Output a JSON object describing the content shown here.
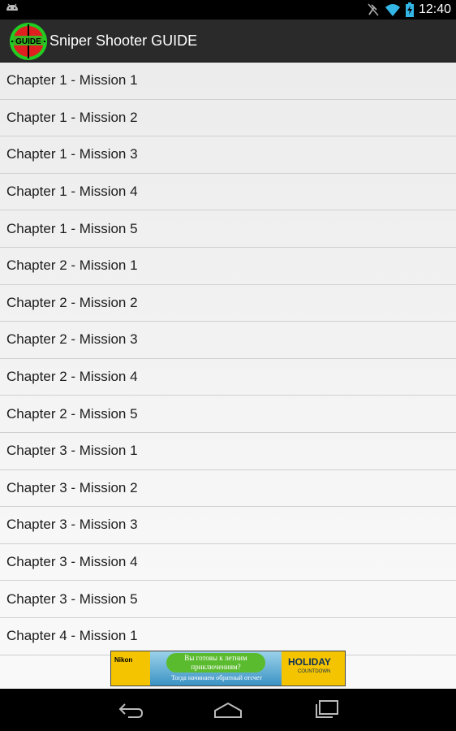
{
  "status_bar": {
    "time": "12:40",
    "icons": [
      "android-debug-icon",
      "no-sync-icon",
      "wifi-icon",
      "battery-charging-icon"
    ]
  },
  "action_bar": {
    "title": "Sniper Shooter GUIDE",
    "icon_label": "GUIDE"
  },
  "missions": [
    "Chapter 1 - Mission 1",
    "Chapter 1 - Mission 2",
    "Chapter 1 - Mission 3",
    "Chapter 1 - Mission 4",
    "Chapter 1 - Mission 5",
    "Chapter 2 - Mission 1",
    "Chapter 2 - Mission 2",
    "Chapter 2 - Mission 3",
    "Chapter 2 - Mission 4",
    "Chapter 2 - Mission 5",
    "Chapter 3 - Mission 1",
    "Chapter 3 - Mission 2",
    "Chapter 3 - Mission 3",
    "Chapter 3 - Mission 4",
    "Chapter 3 - Mission 5",
    "Chapter 4 - Mission 1"
  ],
  "ad": {
    "brand": "Nikon",
    "headline": "Вы готовы к летним приключениям?",
    "subline": "Тогда начинаем обратный отсчет",
    "holiday": "HOLIDAY",
    "countdown": "COUNTDOWN"
  },
  "nav_bar": {
    "buttons": [
      "back-icon",
      "home-icon",
      "recent-apps-icon"
    ]
  },
  "colors": {
    "status_bar": "#000000",
    "action_bar": "#2a2a2a",
    "list_bg": "#ececec",
    "divider": "#d0d0d0",
    "icon_ring": "#22cc22",
    "icon_fill": "#e02020"
  }
}
